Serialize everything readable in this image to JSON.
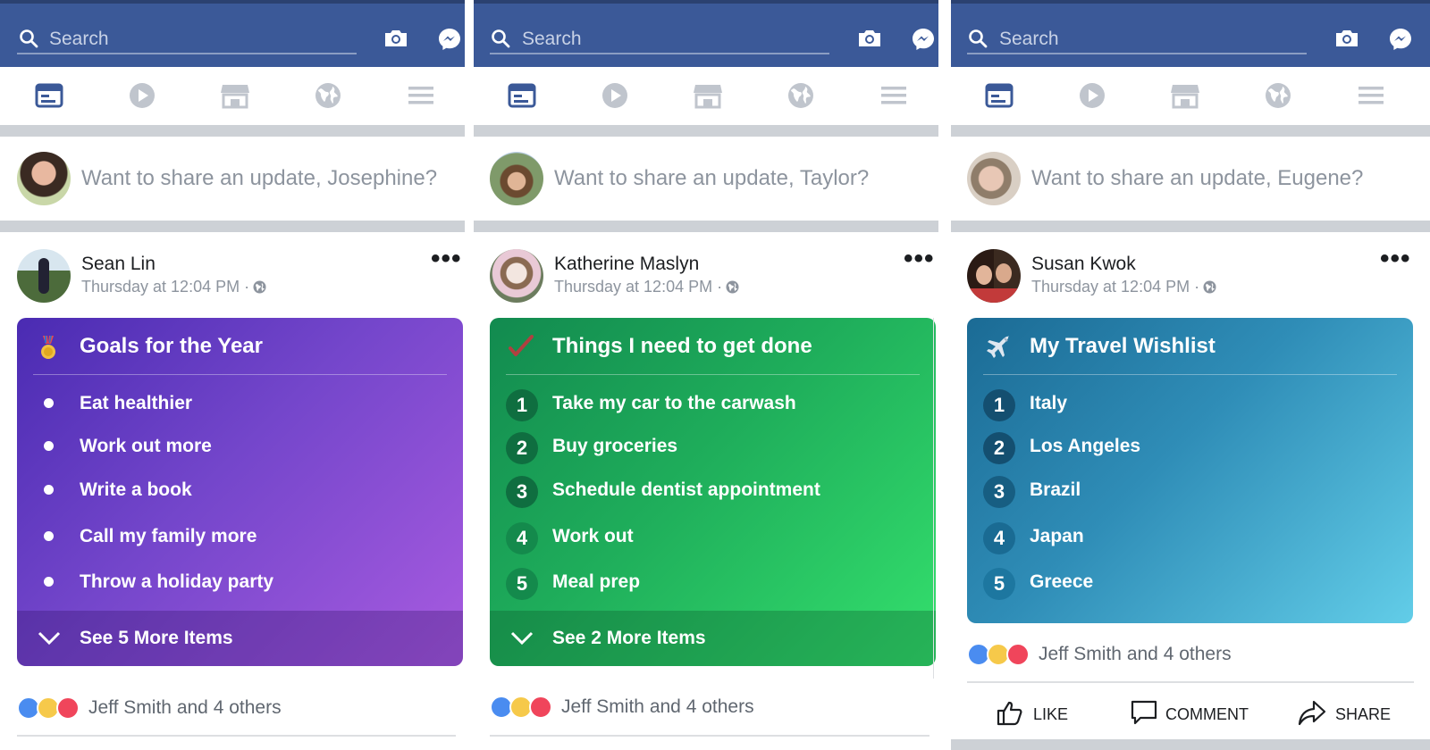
{
  "colors": {
    "brand_blue": "#3b5998",
    "nav_active": "#3b5998",
    "nav_inactive": "#c0c5cd",
    "separator": "#cdd1d6",
    "card1_gradient": [
      "#4a2bb2",
      "#a85be0"
    ],
    "card2_gradient": [
      "#128a4f",
      "#34e06d"
    ],
    "card3_gradient": [
      "#1b6b95",
      "#62cde8"
    ]
  },
  "screens": [
    {
      "search_placeholder": "Search",
      "composer_prompt": "Want to share an update, Josephine?",
      "post": {
        "author": "Sean Lin",
        "time": "Thursday at 12:04 PM ·",
        "more": "•••"
      },
      "card": {
        "icon": "medal-icon",
        "title": "Goals for the Year",
        "list_style": "bullets",
        "items": [
          "Eat healthier",
          "Work out more",
          "Write a book",
          "Call my family more",
          "Throw a holiday party"
        ],
        "see_more": "See 5 More Items"
      },
      "reactions_text": "Jeff Smith and 4 others"
    },
    {
      "search_placeholder": "Search",
      "composer_prompt": "Want to share an update, Taylor?",
      "post": {
        "author": "Katherine Maslyn",
        "time": "Thursday at 12:04 PM ·",
        "more": "•••"
      },
      "card": {
        "icon": "checkmark-icon",
        "title": "Things I need to get done",
        "list_style": "numbers",
        "numbers": [
          "1",
          "2",
          "3",
          "4",
          "5"
        ],
        "items": [
          "Take my car to the carwash",
          "Buy groceries",
          "Schedule dentist appointment",
          "Work out",
          "Meal prep"
        ],
        "see_more": "See 2 More Items"
      },
      "reactions_text": "Jeff Smith and 4 others"
    },
    {
      "search_placeholder": "Search",
      "composer_prompt": "Want to share an update, Eugene?",
      "post": {
        "author": "Susan Kwok",
        "time": "Thursday at 12:04 PM ·",
        "more": "•••"
      },
      "card": {
        "icon": "airplane-icon",
        "title": "My Travel Wishlist",
        "list_style": "numbers",
        "numbers": [
          "1",
          "2",
          "3",
          "4",
          "5"
        ],
        "items": [
          "Italy",
          "Los Angeles",
          "Brazil",
          "Japan",
          "Greece"
        ]
      },
      "reactions_text": "Jeff Smith and 4 others",
      "actions": {
        "like": "LIKE",
        "comment": "COMMENT",
        "share": "SHARE"
      }
    }
  ],
  "icons": {
    "nav": [
      "news-feed-icon",
      "video-icon",
      "marketplace-icon",
      "globe-icon",
      "menu-icon"
    ],
    "top": [
      "search-icon",
      "camera-icon",
      "messenger-icon"
    ],
    "reactions": [
      "like-reaction-icon",
      "wow-reaction-icon",
      "love-reaction-icon"
    ]
  }
}
